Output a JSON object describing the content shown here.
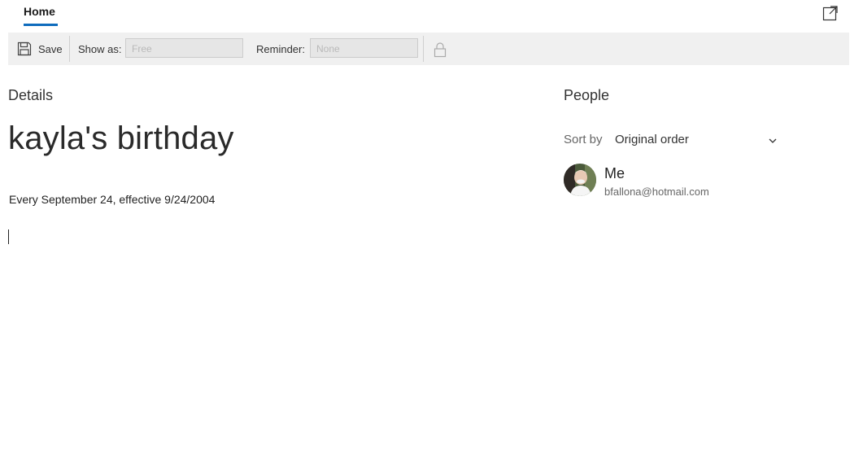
{
  "tabs": [
    {
      "label": "Home"
    }
  ],
  "toolbar": {
    "save_label": "Save",
    "show_as_label": "Show as:",
    "show_as_value": "Free",
    "reminder_label": "Reminder:",
    "reminder_value": "None"
  },
  "details": {
    "heading": "Details",
    "title": "kayla's birthday",
    "recurrence": "Every September 24, effective 9/24/2004"
  },
  "people": {
    "heading": "People",
    "sort_label": "Sort by",
    "sort_value": "Original order",
    "attendees": [
      {
        "name": "Me",
        "email": "bfallona@hotmail.com"
      }
    ]
  },
  "colors": {
    "accent": "#0f6cbd",
    "toolbar_bg": "#f0f0f0"
  },
  "icons": [
    "popout-icon",
    "save-icon",
    "lock-icon",
    "chevron-down-icon",
    "avatar-photo"
  ]
}
